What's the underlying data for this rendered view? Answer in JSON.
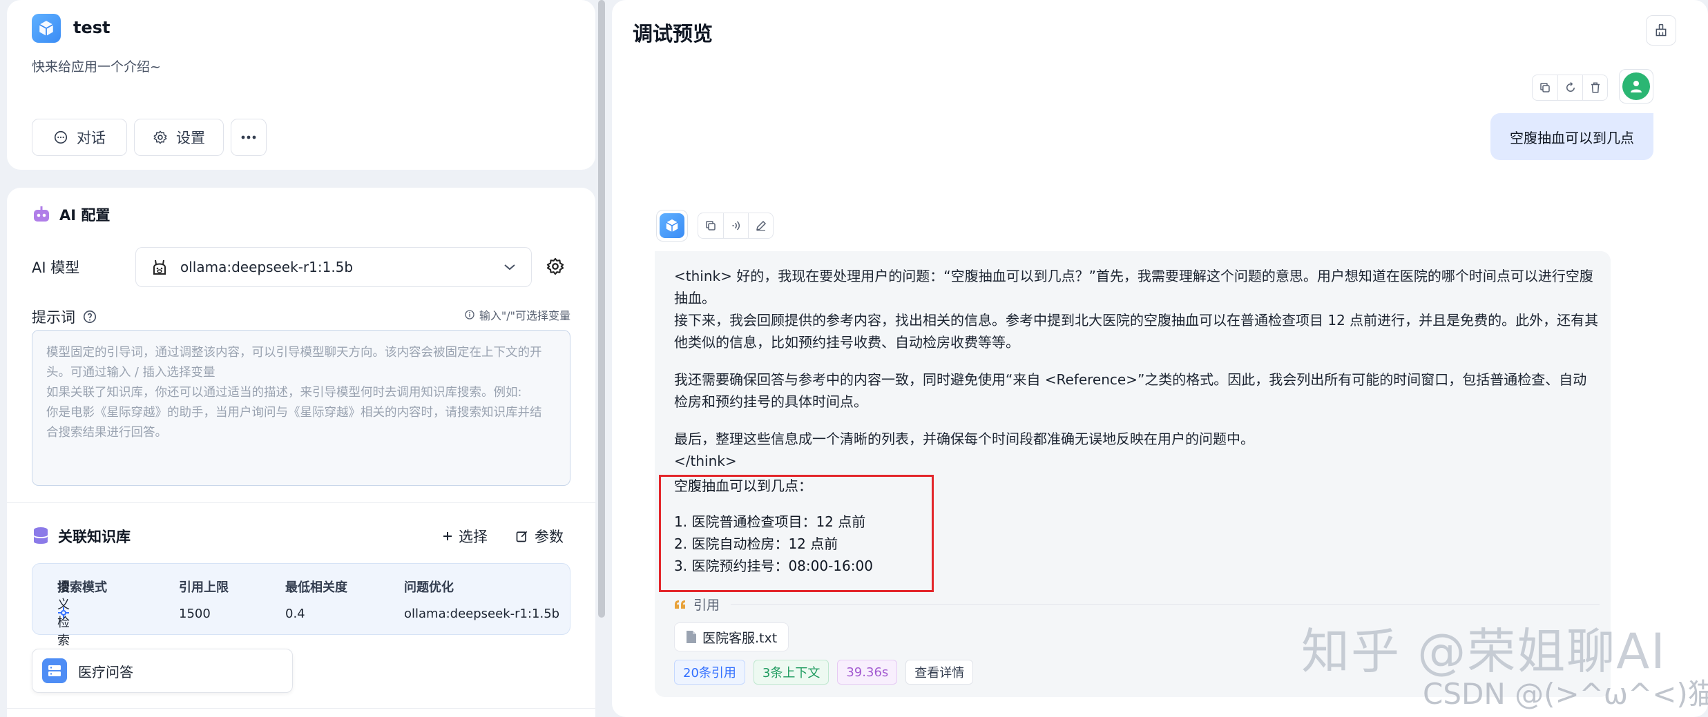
{
  "app": {
    "name": "test",
    "intro": "快来给应用一个介绍~",
    "buttons": {
      "chat": "对话",
      "settings": "设置"
    }
  },
  "ai_config": {
    "title": "AI 配置",
    "model_label": "AI 模型",
    "model_value": "ollama:deepseek-r1:1.5b",
    "prompt_label": "提示词",
    "prompt_hint": "输入\"/\"可选择变量",
    "prompt_placeholder_lines": [
      "模型固定的引导词，通过调整该内容，可以引导模型聊天方向。该内容会被固定在上下文的开",
      "头。可通过输入 / 插入选择变量",
      "如果关联了知识库，你还可以通过适当的描述，来引导模型何时去调用知识库搜索。例如:",
      "你是电影《星际穿越》的助手，当用户询问与《星际穿越》相关的内容时，请搜索知识库并结",
      "合搜索结果进行回答。"
    ]
  },
  "knowledge": {
    "title": "关联知识库",
    "select_label": "选择",
    "params_label": "参数",
    "headers": [
      "搜索模式",
      "引用上限",
      "最低相关度",
      "问题优化"
    ],
    "values": [
      "语义检索",
      "1500",
      "0.4",
      "ollama:deepseek-r1:1.5b"
    ],
    "dataset_name": "医疗问答"
  },
  "preview": {
    "title": "调试预览",
    "user_message": "空腹抽血可以到几点",
    "think_paragraphs": [
      "<think> 好的，我现在要处理用户的问题：“空腹抽血可以到几点？”首先，我需要理解这个问题的意思。用户想知道在医院的哪个时间点可以进行空腹抽血。\n接下来，我会回顾提供的参考内容，找出相关的信息。参考中提到北大医院的空腹抽血可以在普通检查项目 12 点前进行，并且是免费的。此外，还有其他类似的信息，比如预约挂号收费、自动检房收费等等。",
      "我还需要确保回答与参考中的内容一致，同时避免使用“来自 <Reference>”之类的格式。因此，我会列出所有可能的时间窗口，包括普通检查、自动检房和预约挂号的具体时间点。",
      "最后，整理这些信息成一个清晰的列表，并确保每个时间段都准确无误地反映在用户的问题中。\n</think>"
    ],
    "answer_question": "空腹抽血可以到几点：",
    "answer_items": [
      "1. 医院普通检查项目：12 点前",
      "2. 医院自动检房：12 点前",
      "3. 医院预约挂号：08:00-16:00"
    ],
    "quote_label": "引用",
    "file_name": "医院客服.txt",
    "tags": [
      "20条引用",
      "3条上下文",
      "39.36s",
      "查看详情"
    ]
  },
  "watermarks": [
    "知乎 @荣姐聊AI",
    "CSDN @(>^ω^<)猫"
  ],
  "colors": {
    "accent": "#3370ff",
    "highlight_box": "#e3262b",
    "user_bubble": "#e1eaff",
    "user_avatar": "#2bb673"
  }
}
